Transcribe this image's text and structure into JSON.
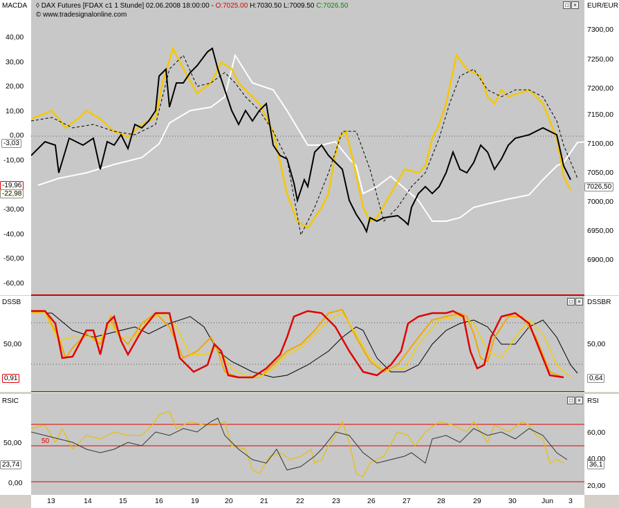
{
  "header": {
    "pane_name": "MACDA",
    "instrument": "DAX Futures [FDAX c1  1 Stunde] 02.06.2008 18:00:00 - ",
    "open": "O:7025.00",
    "high": "H:7030.50",
    "low": "L:7009.50",
    "close": "C:7026.50",
    "source": "www.tradesignalonline.com",
    "currency": "EUR/EUR"
  },
  "macd_pane": {
    "left_ticks": [
      "40,00",
      "30,00",
      "20,00",
      "10,00",
      "0,00",
      "-10,00",
      "-30,00",
      "-40,00",
      "-50,00",
      "-60,00"
    ],
    "right_ticks": [
      "7300,00",
      "7250,00",
      "7200,00",
      "7150,00",
      "7100,00",
      "7050,00",
      "7000,00",
      "6950,00",
      "6900,00"
    ],
    "left_markers": [
      "-3,03",
      "-19,96",
      "-22,98"
    ],
    "right_marker": "7026,50"
  },
  "dssb_pane": {
    "label_left": "DSSB",
    "label_right": "DSSBR",
    "left_tick": "50,00",
    "right_tick": "50,00",
    "left_marker": "0,91",
    "right_marker": "0,64"
  },
  "rsi_pane": {
    "label_left": "RSIC",
    "label_right": "RSI",
    "left_ticks": [
      "50,00",
      "0,00"
    ],
    "right_ticks": [
      "60,00",
      "40,00",
      "20,00"
    ],
    "level_label": "50",
    "left_marker": "23,74",
    "right_marker": "36,1"
  },
  "x_axis": [
    "13",
    "14",
    "15",
    "16",
    "19",
    "20",
    "21",
    "22",
    "23",
    "26",
    "27",
    "28",
    "29",
    "30",
    "Jun",
    "3"
  ],
  "colors": {
    "yellow": "#f5c800",
    "red": "#e00000",
    "white": "#ffffff",
    "black": "#000000",
    "pane_bg": "#c8c8c8"
  }
}
